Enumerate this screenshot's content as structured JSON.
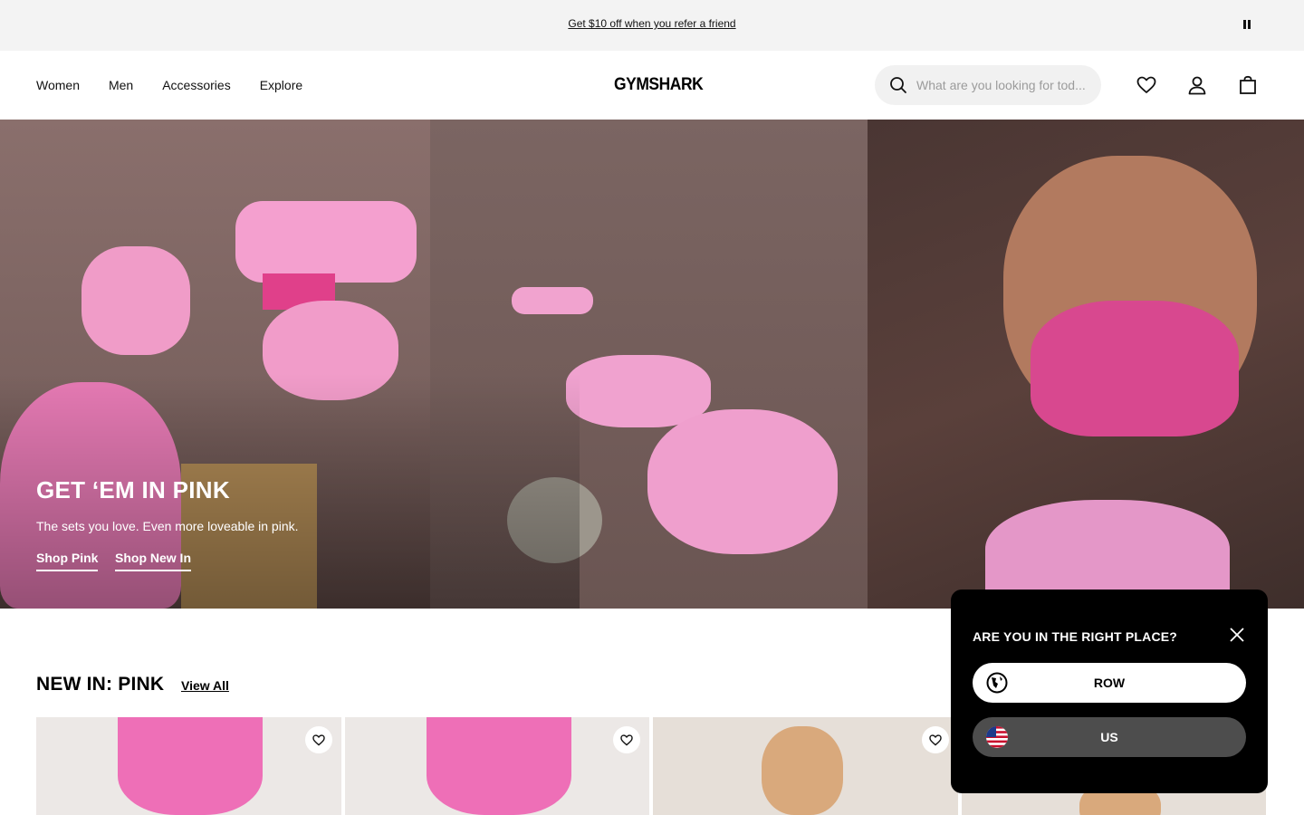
{
  "promo": {
    "text": "Get $10 off when you refer a friend"
  },
  "nav": {
    "items": [
      "Women",
      "Men",
      "Accessories",
      "Explore"
    ]
  },
  "brand": {
    "logo_text": "GYMSHARK"
  },
  "search": {
    "placeholder": "What are you looking for tod..."
  },
  "header_icons": [
    "heart-icon",
    "account-icon",
    "bag-icon"
  ],
  "hero": {
    "title": "GET ‘EM IN PINK",
    "subtitle": "The sets you love. Even more loveable in pink.",
    "cta_primary": "Shop Pink",
    "cta_secondary": "Shop New In"
  },
  "section": {
    "title": "NEW IN: PINK",
    "view_all": "View All"
  },
  "region_popup": {
    "title": "ARE YOU IN THE RIGHT PLACE?",
    "options": [
      "ROW",
      "US"
    ]
  },
  "colors": {
    "promo_bg": "#f3f3f3",
    "search_bg": "#f1f1f1",
    "popup_bg": "#000000",
    "us_button_bg": "#4d4d4d",
    "pink": "#ee7bc3"
  }
}
